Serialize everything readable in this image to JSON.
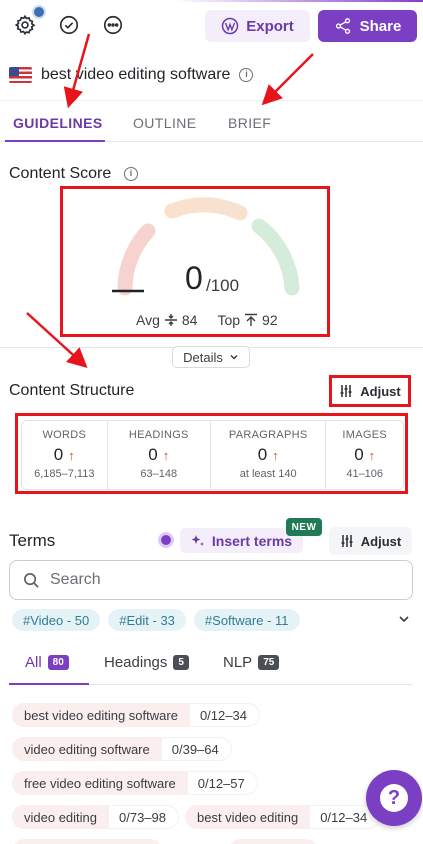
{
  "header": {
    "settings_icon": "gear-icon",
    "check_icon": "check-circle-icon",
    "more_icon": "more-dots-icon",
    "export_label": "Export",
    "share_label": "Share",
    "accent_color": "#7b3fc4"
  },
  "query": {
    "flag": "us-flag-icon",
    "text": "best video editing software"
  },
  "tabs": [
    {
      "label": "GUIDELINES",
      "active": true
    },
    {
      "label": "OUTLINE",
      "active": false
    },
    {
      "label": "BRIEF",
      "active": false
    }
  ],
  "content_score": {
    "title": "Content Score",
    "score": "0",
    "max": "/100",
    "avg_label": "Avg",
    "avg_value": "84",
    "top_label": "Top",
    "top_value": "92",
    "details_label": "Details",
    "gauge_colors": [
      "#f6d3cf",
      "#f9e1cf",
      "#d6ecda"
    ]
  },
  "content_structure": {
    "title": "Content Structure",
    "adjust_label": "Adjust",
    "stats": [
      {
        "label": "WORDS",
        "value": "0",
        "range": "6,185–7,113"
      },
      {
        "label": "HEADINGS",
        "value": "0",
        "range": "63–148"
      },
      {
        "label": "PARAGRAPHS",
        "value": "0",
        "range": "at least 140"
      },
      {
        "label": "IMAGES",
        "value": "0",
        "range": "41–106"
      }
    ]
  },
  "terms": {
    "title": "Terms",
    "insert_label": "Insert terms",
    "new_badge": "NEW",
    "adjust_label": "Adjust",
    "search_placeholder": "Search",
    "chips": [
      "#Video - 50",
      "#Edit - 33",
      "#Software - 11"
    ],
    "filters": [
      {
        "label": "All",
        "count": "80"
      },
      {
        "label": "Headings",
        "count": "5"
      },
      {
        "label": "NLP",
        "count": "75"
      }
    ],
    "items": [
      {
        "name": "best video editing software",
        "count": "0/12–34"
      },
      {
        "name": "video editing software",
        "count": "0/39–64"
      },
      {
        "name": "free video editing software",
        "count": "0/12–57"
      },
      {
        "name": "video editing",
        "count": "0/73–98"
      },
      {
        "name": "best video editing",
        "count": "0/12–34"
      }
    ]
  },
  "help": {
    "label": "?"
  }
}
